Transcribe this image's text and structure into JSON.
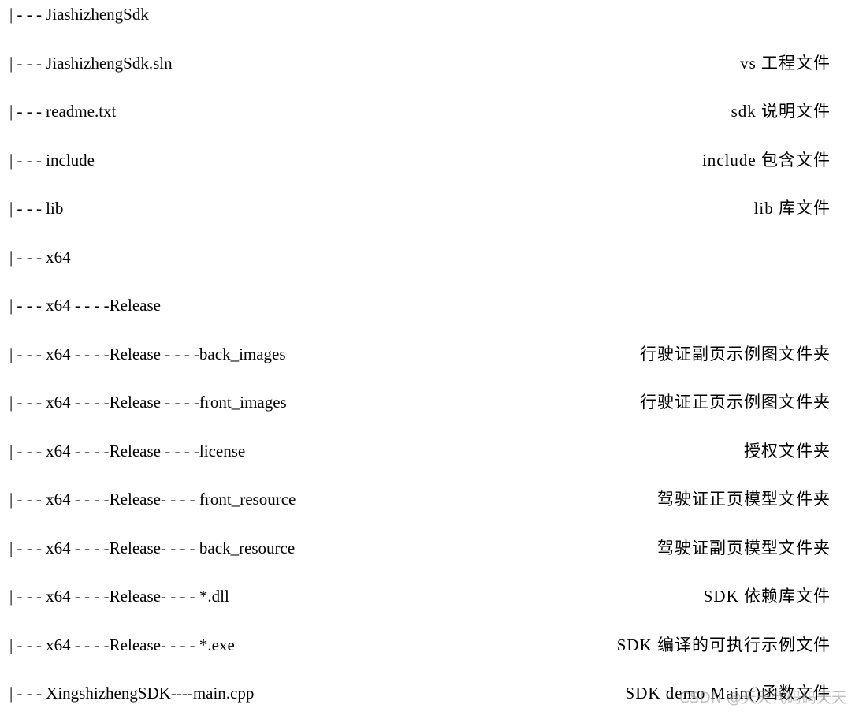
{
  "rows": [
    {
      "path": "| - - - JiashizhengSdk",
      "desc": ""
    },
    {
      "path": "| - - - JiashizhengSdk.sln",
      "desc": "vs 工程文件"
    },
    {
      "path": "| - - - readme.txt",
      "desc": "sdk 说明文件"
    },
    {
      "path": "| - - - include",
      "desc": "include 包含文件"
    },
    {
      "path": "| - - - lib",
      "desc": "lib 库文件"
    },
    {
      "path": "| - - - x64",
      "desc": ""
    },
    {
      "path": "| - - - x64 - - - -Release",
      "desc": ""
    },
    {
      "path": "| - - - x64 - - - -Release - - - -back_images",
      "desc": "行驶证副页示例图文件夹"
    },
    {
      "path": "| - - - x64 - - - -Release - - - -front_images",
      "desc": "行驶证正页示例图文件夹"
    },
    {
      "path": "| - - - x64 - - - -Release - - - -license",
      "desc": "授权文件夹"
    },
    {
      "path": "| - - - x64 - - - -Release- - - - front_resource",
      "desc": "驾驶证正页模型文件夹"
    },
    {
      "path": "| - - - x64 - - - -Release- - - - back_resource",
      "desc": "驾驶证副页模型文件夹"
    },
    {
      "path": "| - - - x64 - - - -Release- - - - *.dll",
      "desc": "SDK 依赖库文件"
    },
    {
      "path": "| - - - x64 - - - -Release- - - - *.exe",
      "desc": "SDK 编译的可执行示例文件"
    },
    {
      "path": "| - - - XingshizhengSDK----main.cpp",
      "desc": "SDK demo Main()函数文件"
    }
  ],
  "watermark": "CSDN @天天代码码天天"
}
